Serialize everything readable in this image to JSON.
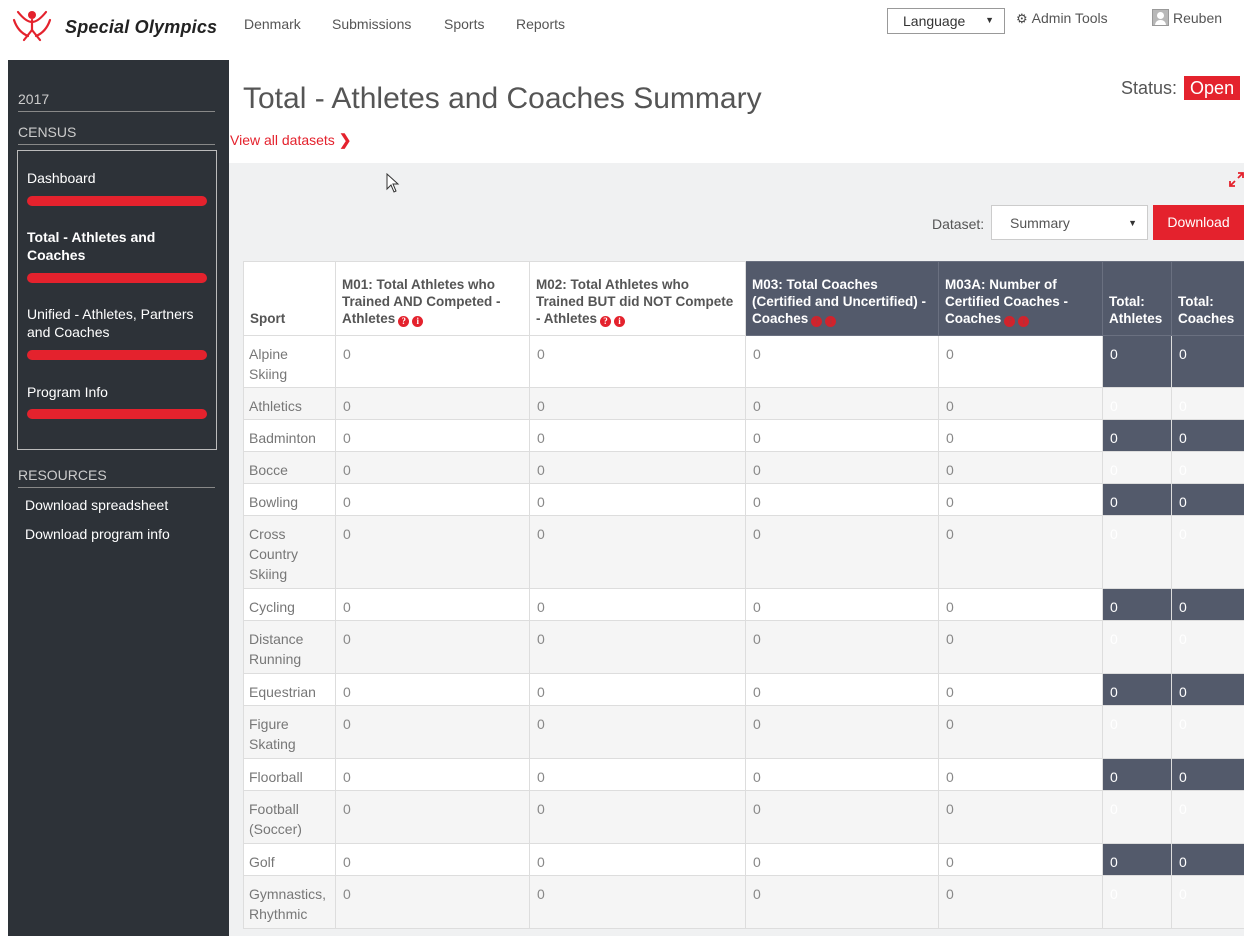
{
  "brand": {
    "name": "Special Olympics",
    "accent": "#e4222d"
  },
  "nav": {
    "links": [
      "Denmark",
      "Submissions",
      "Sports",
      "Reports"
    ],
    "language_label": "Language",
    "admin_label": "Admin Tools",
    "user_name": "Reuben"
  },
  "sidebar": {
    "year": "2017",
    "section": "CENSUS",
    "items": [
      {
        "label": "Dashboard"
      },
      {
        "label": "Total - Athletes and Coaches"
      },
      {
        "label": "Unified - Athletes, Partners and Coaches"
      },
      {
        "label": "Program Info"
      }
    ],
    "resources_title": "RESOURCES",
    "resources": [
      "Download spreadsheet",
      "Download program info"
    ]
  },
  "main": {
    "title": "Total - Athletes and Coaches Summary",
    "view_all": "View all datasets",
    "status_label": "Status:",
    "status_value": "Open",
    "dataset_label": "Dataset:",
    "dataset_value": "Summary",
    "download_label": "Download"
  },
  "table": {
    "headers": {
      "sport": "Sport",
      "m01": "M01: Total Athletes who Trained AND Competed - Athletes",
      "m02": "M02: Total Athletes who Trained BUT did NOT Compete - Athletes",
      "m03": "M03: Total Coaches (Certified and Uncertified) - Coaches",
      "m03a": "M03A: Number of Certified Coaches - Coaches",
      "total_athletes": "Total: Athletes",
      "total_coaches": "Total: Coaches"
    },
    "rows": [
      {
        "sport": "Alpine Skiing",
        "m01": "0",
        "m02": "0",
        "m03": "0",
        "m03a": "0",
        "ta": "0",
        "tc": "0"
      },
      {
        "sport": "Athletics",
        "m01": "0",
        "m02": "0",
        "m03": "0",
        "m03a": "0",
        "ta": "0",
        "tc": "0"
      },
      {
        "sport": "Badminton",
        "m01": "0",
        "m02": "0",
        "m03": "0",
        "m03a": "0",
        "ta": "0",
        "tc": "0"
      },
      {
        "sport": "Bocce",
        "m01": "0",
        "m02": "0",
        "m03": "0",
        "m03a": "0",
        "ta": "0",
        "tc": "0"
      },
      {
        "sport": "Bowling",
        "m01": "0",
        "m02": "0",
        "m03": "0",
        "m03a": "0",
        "ta": "0",
        "tc": "0"
      },
      {
        "sport": "Cross Country Skiing",
        "m01": "0",
        "m02": "0",
        "m03": "0",
        "m03a": "0",
        "ta": "0",
        "tc": "0"
      },
      {
        "sport": "Cycling",
        "m01": "0",
        "m02": "0",
        "m03": "0",
        "m03a": "0",
        "ta": "0",
        "tc": "0"
      },
      {
        "sport": "Distance Running",
        "m01": "0",
        "m02": "0",
        "m03": "0",
        "m03a": "0",
        "ta": "0",
        "tc": "0"
      },
      {
        "sport": "Equestrian",
        "m01": "0",
        "m02": "0",
        "m03": "0",
        "m03a": "0",
        "ta": "0",
        "tc": "0"
      },
      {
        "sport": "Figure Skating",
        "m01": "0",
        "m02": "0",
        "m03": "0",
        "m03a": "0",
        "ta": "0",
        "tc": "0"
      },
      {
        "sport": "Floorball",
        "m01": "0",
        "m02": "0",
        "m03": "0",
        "m03a": "0",
        "ta": "0",
        "tc": "0"
      },
      {
        "sport": "Football (Soccer)",
        "m01": "0",
        "m02": "0",
        "m03": "0",
        "m03a": "0",
        "ta": "0",
        "tc": "0"
      },
      {
        "sport": "Golf",
        "m01": "0",
        "m02": "0",
        "m03": "0",
        "m03a": "0",
        "ta": "0",
        "tc": "0"
      },
      {
        "sport": "Gymnastics, Rhythmic",
        "m01": "0",
        "m02": "0",
        "m03": "0",
        "m03a": "0",
        "ta": "0",
        "tc": "0"
      }
    ]
  }
}
